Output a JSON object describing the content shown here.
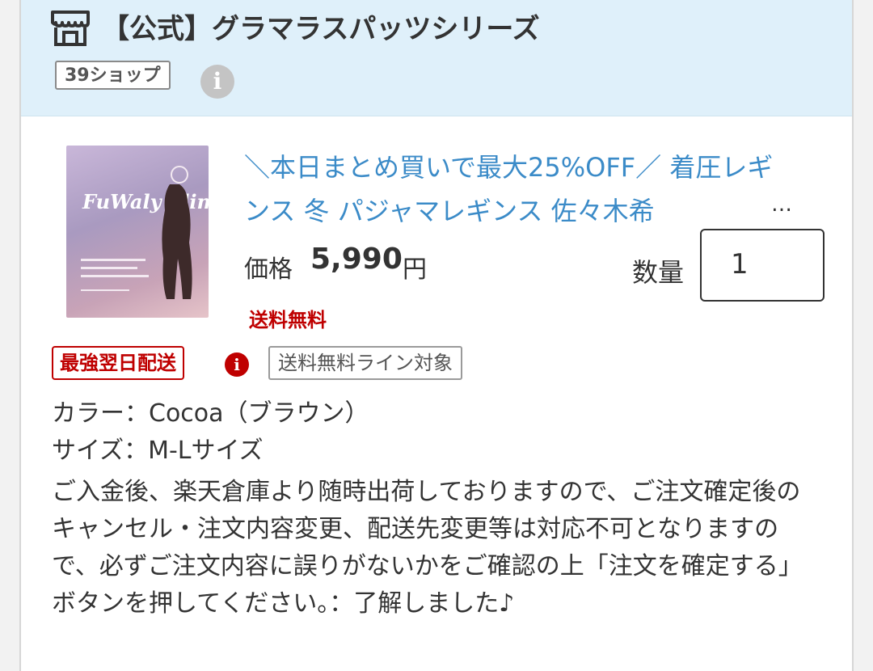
{
  "shop": {
    "name": "【公式】グラマラスパッツシリーズ",
    "badge": "39ショップ",
    "info_icon_glyph": "i"
  },
  "product": {
    "image_brand": "FuWaly Slim",
    "title": "＼本日まとめ買いで最大25%OFF／ 着圧レギンス 冬 パジャマレギンス 佐々木希",
    "ellipsis": "…",
    "price_label": "価格",
    "price_value": "5,990",
    "price_unit": "円",
    "shipping": "送料無料",
    "quantity_label": "数量",
    "quantity_value": "1"
  },
  "badges": {
    "fast_delivery": "最強翌日配送",
    "info_glyph": "i",
    "free_shipping_line": "送料無料ライン対象"
  },
  "options": {
    "color": "カラー：Cocoa（ブラウン）",
    "size": "サイズ：M-Lサイズ"
  },
  "notice": "ご入金後、楽天倉庫より随時出荷しておりますので、ご注文確定後のキャンセル・注文内容変更、配送先変更等は対応不可となりますので、必ずご注文内容に誤りがないかをご確認の上「注文を確定する」ボタンを押してください。：了解しました♪",
  "colors": {
    "header_bg": "#dff0fa",
    "link_blue": "#3b8bc8",
    "red": "#bf0000"
  }
}
